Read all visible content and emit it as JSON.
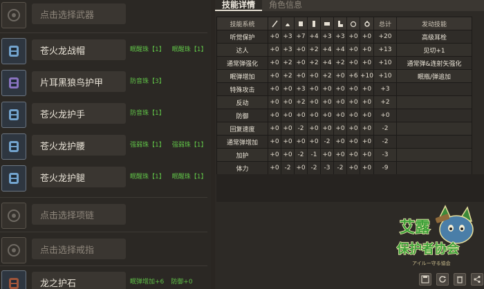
{
  "equipment": {
    "slots": [
      {
        "name": "点击选择武器",
        "empty": true,
        "decos": []
      },
      {
        "name": "苍火龙战帽",
        "empty": false,
        "decos": [
          "眠醒珠【1】",
          "眠醒珠【1】"
        ]
      },
      {
        "name": "片耳黑狼鸟护甲",
        "empty": false,
        "decos": [
          "防音珠【3】"
        ]
      },
      {
        "name": "苍火龙护手",
        "empty": false,
        "decos": [
          "防音珠【1】"
        ]
      },
      {
        "name": "苍火龙护腰",
        "empty": false,
        "decos": [
          "强弱珠【1】",
          "强弱珠【1】"
        ]
      },
      {
        "name": "苍火龙护腿",
        "empty": false,
        "decos": [
          "眠醒珠【1】",
          "眠醒珠【1】"
        ]
      },
      {
        "name": "点击选择项链",
        "empty": true,
        "decos": []
      },
      {
        "name": "点击选择戒指",
        "empty": true,
        "decos": []
      },
      {
        "name": "龙之护石",
        "empty": false,
        "decos": [
          "眠弹增加+6",
          "防御+0"
        ]
      }
    ]
  },
  "tabs": [
    {
      "label": "技能详情",
      "active": true
    },
    {
      "label": "角色信息",
      "active": false
    }
  ],
  "skills": {
    "headers": {
      "system": "技能系统",
      "total": "总计",
      "effect": "发动技能",
      "part_icons": [
        "weapon-icon",
        "helm-icon",
        "chest-icon",
        "arms-icon",
        "waist-icon",
        "legs-icon",
        "necklace-icon",
        "ring-icon"
      ]
    },
    "rows": [
      {
        "name": "听觉保护",
        "vals": [
          "+0",
          "+3",
          "+7",
          "+4",
          "+3",
          "+3",
          "+0",
          "+0"
        ],
        "total": "+20",
        "effect": "高级耳栓"
      },
      {
        "name": "达人",
        "vals": [
          "+0",
          "+3",
          "+0",
          "+2",
          "+4",
          "+4",
          "+0",
          "+0"
        ],
        "total": "+13",
        "effect": "见切+1"
      },
      {
        "name": "通常弹强化",
        "vals": [
          "+0",
          "+2",
          "+0",
          "+2",
          "+4",
          "+2",
          "+0",
          "+0"
        ],
        "total": "+10",
        "effect": "通常弹&连射矢强化"
      },
      {
        "name": "眠弹增加",
        "vals": [
          "+0",
          "+2",
          "+0",
          "+0",
          "+2",
          "+0",
          "+6",
          "+10"
        ],
        "total": "+10",
        "effect": "眠瓶/弹追加"
      },
      {
        "name": "特殊攻击",
        "vals": [
          "+0",
          "+0",
          "+3",
          "+0",
          "+0",
          "+0",
          "+0",
          "+0"
        ],
        "total": "+3",
        "effect": ""
      },
      {
        "name": "反动",
        "vals": [
          "+0",
          "+0",
          "+2",
          "+0",
          "+0",
          "+0",
          "+0",
          "+0"
        ],
        "total": "+2",
        "effect": ""
      },
      {
        "name": "防御",
        "vals": [
          "+0",
          "+0",
          "+0",
          "+0",
          "+0",
          "+0",
          "+0",
          "+0"
        ],
        "total": "+0",
        "effect": ""
      },
      {
        "name": "回复速度",
        "vals": [
          "+0",
          "+0",
          "-2",
          "+0",
          "+0",
          "+0",
          "+0",
          "+0"
        ],
        "total": "-2",
        "effect": ""
      },
      {
        "name": "通常弹增加",
        "vals": [
          "+0",
          "+0",
          "+0",
          "+0",
          "-2",
          "+0",
          "+0",
          "+0"
        ],
        "total": "-2",
        "effect": ""
      },
      {
        "name": "加护",
        "vals": [
          "+0",
          "+0",
          "-2",
          "-1",
          "+0",
          "+0",
          "+0",
          "+0"
        ],
        "total": "-3",
        "effect": ""
      },
      {
        "name": "体力",
        "vals": [
          "+0",
          "-2",
          "+0",
          "-2",
          "-3",
          "-2",
          "+0",
          "+0"
        ],
        "total": "-9",
        "effect": ""
      }
    ]
  },
  "logo": {
    "title_line1": "艾露",
    "title_line2": "保护者协会",
    "caption": "アイルー守る協会"
  },
  "toolbar": [
    "save-icon",
    "refresh-icon",
    "delete-icon",
    "share-icon"
  ]
}
